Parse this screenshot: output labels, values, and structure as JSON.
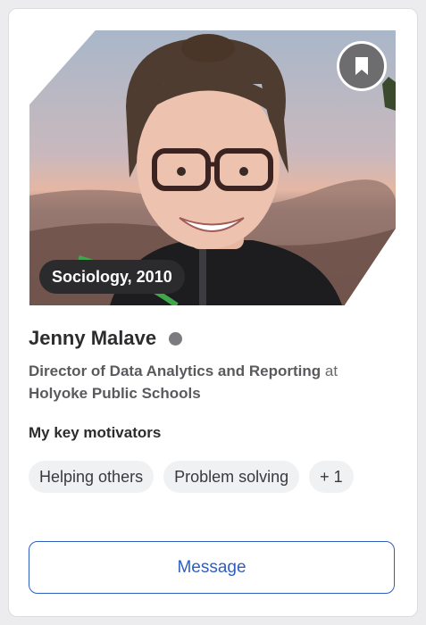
{
  "profile": {
    "tag": "Sociology, 2010",
    "name": "Jenny Malave",
    "role_title": "Director of Data Analytics and Reporting",
    "role_at": " at ",
    "organization": "Holyoke Public Schools",
    "status_color": "#7b7b80"
  },
  "motivators": {
    "title": "My key motivators",
    "chips": [
      "Helping others",
      "Problem solving",
      "+ 1"
    ]
  },
  "actions": {
    "message_label": "Message",
    "bookmark_icon": "bookmark-icon"
  },
  "colors": {
    "accent": "#2f5ec2",
    "tag_bg": "#2b2b2e"
  }
}
